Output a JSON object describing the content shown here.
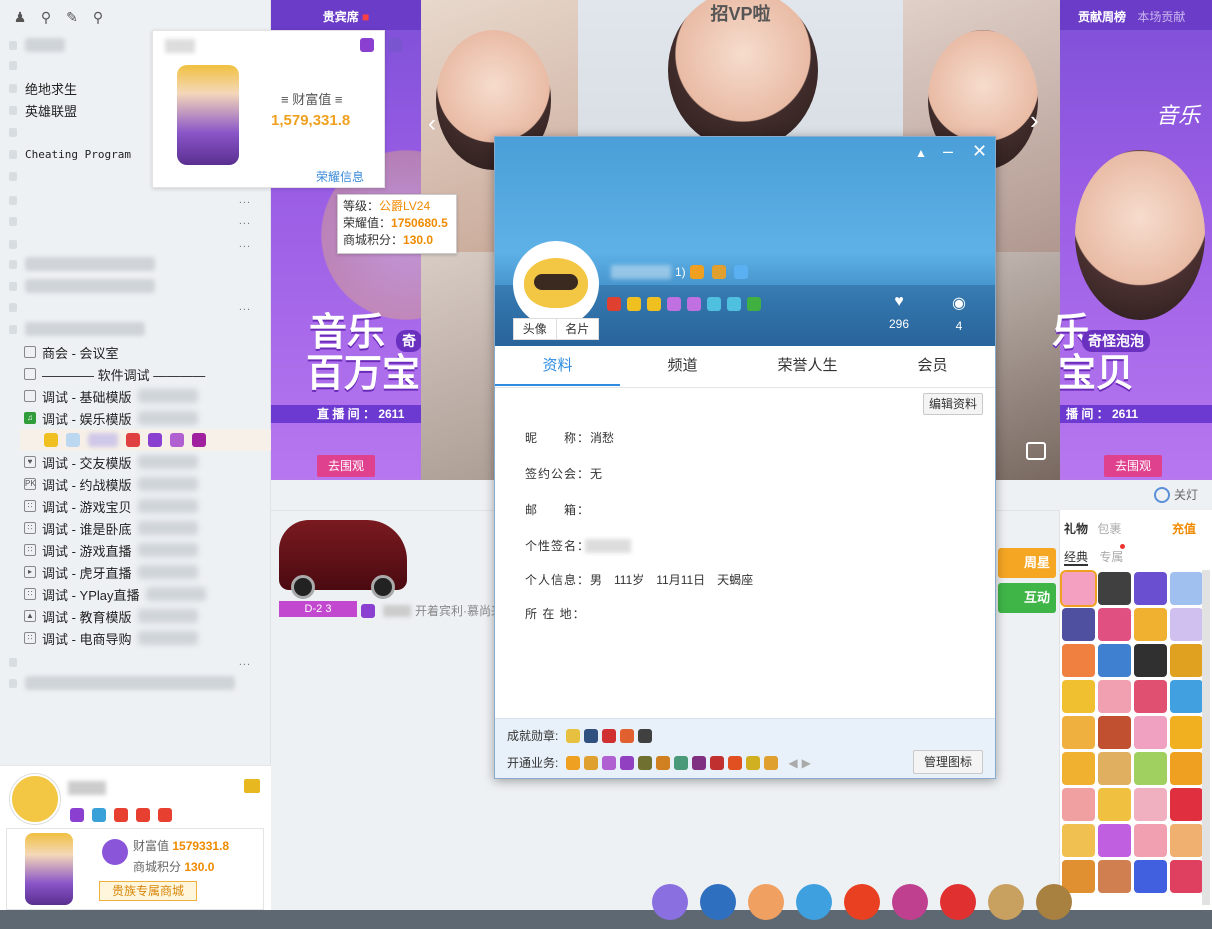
{
  "sidebar": {
    "games": [
      "绝地求生",
      "英雄联盟"
    ],
    "cheating": "Cheating Program",
    "channels": [
      {
        "label": "商会 - 会议室"
      },
      {
        "label": "———— 软件调试 ————"
      },
      {
        "label": "调试 - 基础模版"
      },
      {
        "label": "调试 - 娱乐模版"
      },
      {
        "label": "调试 - 交友模版"
      },
      {
        "label": "调试 - 约战模版"
      },
      {
        "label": "调试 - 游戏宝贝"
      },
      {
        "label": "调试 - 谁是卧底"
      },
      {
        "label": "调试 - 游戏直播"
      },
      {
        "label": "调试 - 虎牙直播"
      },
      {
        "label": "调试 - YPlay直播"
      },
      {
        "label": "调试 - 教育模版"
      },
      {
        "label": "调试 - 电商导购"
      }
    ],
    "dots": "...",
    "user": {
      "wealth_label": "财富值",
      "wealth": "1579331.8",
      "points_label": "商城积分",
      "points": "130.0",
      "mall_button": "贵族专属商城"
    }
  },
  "wealth_card": {
    "title": "财富值",
    "value": "1,579,331.8",
    "link": "荣耀信息"
  },
  "level_tip": {
    "level_label": "等级：",
    "level": "公爵LV24",
    "honor_label": "荣耀值：",
    "honor": "1750680.5",
    "points_label": "商城积分：",
    "points": "130.0"
  },
  "stage": {
    "vip_seat": "贵宾席",
    "top_text": "招VP啦",
    "rank_tab": "贡献周榜",
    "rank_tab2": "本场贡献",
    "left_promo": {
      "line1": "音乐",
      "line2": "百万宝",
      "badge": "奇",
      "live_label": "直 播 间 ： 2611",
      "button": "去围观"
    },
    "right_promo": {
      "line1": "乐",
      "line2": "宝贝",
      "badge": "奇怪泡泡",
      "live_label": "播 间 ： 2611",
      "button": "去围观",
      "logo": "音乐"
    },
    "light_off": "关灯"
  },
  "lower": {
    "car_plate": "D-2  3",
    "message": "开着宾利·慕尚来",
    "gift_tab": "礼物",
    "pack_tab": "包裹",
    "recharge": "充值",
    "classic_tab": "经典",
    "exclusive_tab": "专属",
    "week_star": "周星",
    "interact": "互动"
  },
  "dialog": {
    "name_suffix": "1)",
    "likes": "296",
    "badge_count": "4",
    "avatar_btn": "头像",
    "card_btn": "名片",
    "tabs": [
      "资料",
      "频道",
      "荣誉人生",
      "会员"
    ],
    "edit_btn": "编辑资料",
    "fields": [
      {
        "label": "昵　　称：",
        "value": "消愁"
      },
      {
        "label": "签约公会：",
        "value": "无"
      },
      {
        "label": "邮　　箱：",
        "value": ""
      },
      {
        "label": "个性签名：",
        "value": ""
      },
      {
        "label": "个人信息：",
        "value": "男　111岁　11月11日　天蝎座"
      },
      {
        "label": "所 在 地：",
        "value": ""
      }
    ],
    "achievement_label": "成就勋章:",
    "services_label": "开通业务:",
    "manage_btn": "管理图标"
  },
  "colors": {
    "accent_blue": "#4a9fd8",
    "tab_underline": "#2f8ce0",
    "orange": "#f08a00",
    "purple": "#8b55e0"
  }
}
